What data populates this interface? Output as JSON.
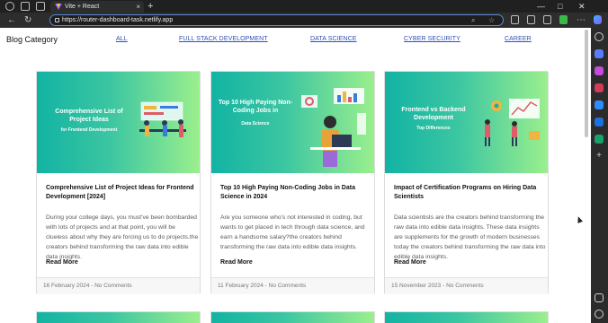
{
  "browser": {
    "tab_title": "Vite + React",
    "tab_close": "×",
    "new_tab": "+",
    "url": "https://router-dashboard-task.netlify.app",
    "win_minimize": "—",
    "win_maximize": "□",
    "win_close": "✕",
    "nav_back": "←",
    "nav_refresh": "↻",
    "more_menu": "⋯",
    "accent": "#5a8dd6"
  },
  "page": {
    "category_title": "Blog Category",
    "categories": [
      "ALL",
      "FULL STACK DEVELOPMENT",
      "DATA SCIENCE",
      "CYBER SECURITY",
      "CAREER"
    ],
    "link_color": "#2f4fb8",
    "banner_gradient": [
      "#12b3a3",
      "#9bef8d"
    ],
    "read_more": "Read More",
    "posts": [
      {
        "banner_title": "Comprehensive List of Project Ideas",
        "banner_sub": "for Frontend Development",
        "title": "Comprehensive List of Project Ideas for Frontend Development [2024]",
        "excerpt": "During your college days, you must've been bombarded with lots of projects and at that point, you will be clueless about why they are forcing us to do projects.the creators behind transforming the raw data into edible data insights.",
        "date": "16 February 2024",
        "comments": "No Comments"
      },
      {
        "banner_title": "Top 10 High Paying Non-Coding Jobs in",
        "banner_sub": "Data Science",
        "title": "Top 10 High Paying Non-Coding Jobs in Data Science in 2024",
        "excerpt": "Are you someone who's not interested in coding, but wants to get placed in tech through data science, and earn a handsome salary?the creators behind transforming the raw data into edible data insights.",
        "date": "11 February 2024",
        "comments": "No Comments"
      },
      {
        "banner_title": "Frontend vs Backend Development",
        "banner_sub": "Top Differences",
        "title": "Impact of Certification Programs on Hiring Data Scientists",
        "excerpt": "Data scientists are the creators behind transforming the raw data into edible data insights. These data insights are supplements for the growth of modern businesses today the creators behind transforming the raw data into edible data insights.",
        "date": "15 November 2023",
        "comments": "No Comments"
      }
    ]
  }
}
